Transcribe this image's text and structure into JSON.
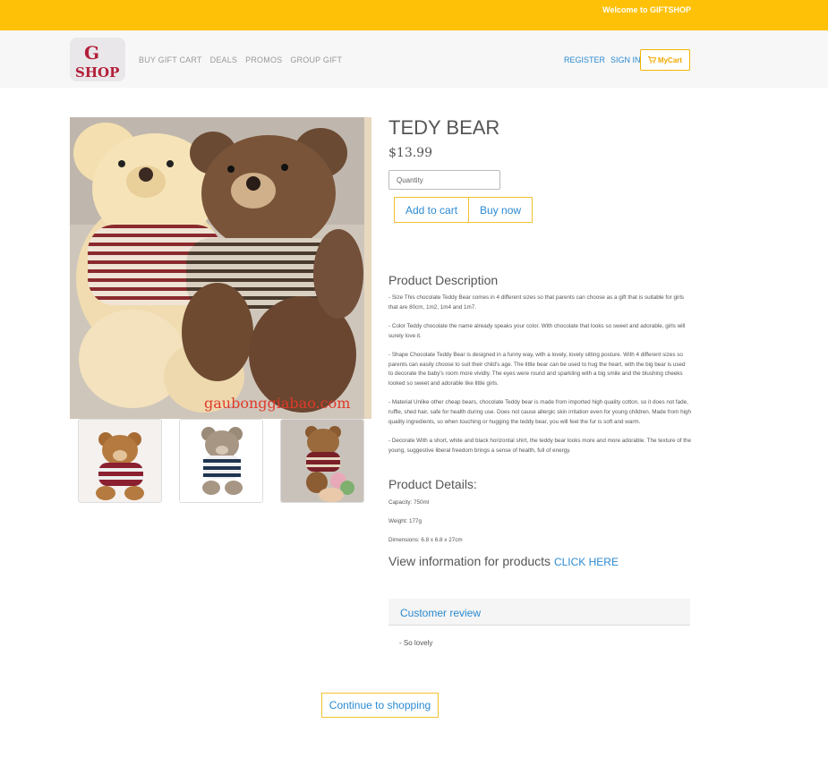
{
  "topbar": {
    "welcome": "Welcome to GIFTSHOP",
    "color": "#fec107"
  },
  "logo": {
    "line1": "G",
    "line2": "SHOP"
  },
  "nav": {
    "items": [
      "BUY GIFT CART",
      "DEALS",
      "PROMOS",
      "GROUP GIFT"
    ]
  },
  "auth": {
    "register": "REGISTER",
    "signin": "SIGN IN"
  },
  "cart": {
    "label": "MyCart",
    "icon": "shopping-cart-icon"
  },
  "product": {
    "title": "TEDY BEAR",
    "price": "$13.99",
    "quantity_placeholder": "Quantity",
    "add_to_cart": "Add to cart",
    "buy_now": "Buy now",
    "image_caption": "gaubonggiabao.com"
  },
  "description": {
    "heading": "Product Description",
    "paragraphs": [
      "- Size This chocolate Teddy Bear comes in 4 different sizes so that parents can choose as a gift that is suitable for girls that are 80cm, 1m2, 1m4 and 1m7.",
      "- Color Teddy chocolate the name already speaks your color. With chocolate that looks so sweet and adorable, girls will surely love it.",
      "- Shape Chocolate Teddy Bear is designed in a funny way, with a lovely, lovely sitting posture. With 4 different sizes so parents can easily choose to suit their child's age. The little bear can be used to hug the heart, with the big bear is used to decorate the baby's room more vividly. The eyes were round and sparkling with a big smile and the blushing cheeks looked so sweet and adorable like little girls.",
      "- Material Unlike other cheap bears, chocolate Teddy bear is made from imported high quality cotton, so it does not fade, ruffle, shed hair, safe for health during use. Does not cause allergic skin irritation even for young children. Made from high quality ingredients, so when touching or hugging the teddy bear, you will feel the fur is soft and warm.",
      "- Decorate With a short, white and black horizontal shirt, the teddy bear looks more and more adorable. The texture of the young, suggestive liberal freedom brings a sense of health, full of energy."
    ]
  },
  "details": {
    "heading": "Product Details:",
    "capacity": "Capacity: 750ml",
    "weight": "Weight: 177g",
    "dimensions": "Dimensions: 6.8 x 6.8 x 27cm"
  },
  "viewinfo": {
    "text": "View information for products",
    "link": "CLICK HERE"
  },
  "review": {
    "heading": "Customer review",
    "items": [
      "- So lovely"
    ]
  },
  "footer": {
    "continue": "Continue to shopping"
  },
  "colors": {
    "accent": "#2b8ad1",
    "border": "#f1c232",
    "brand_red": "#b3203a"
  }
}
